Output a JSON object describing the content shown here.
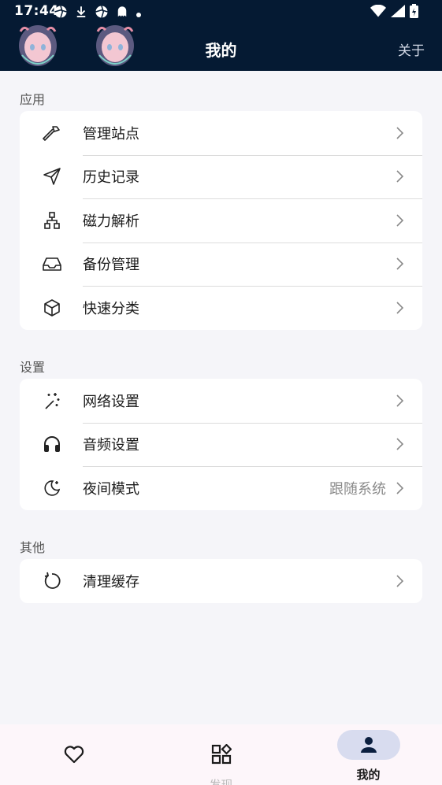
{
  "status_bar": {
    "time": "17:44",
    "left_icons": [
      "aperture-icon",
      "download-icon",
      "aperture-icon",
      "ghost-icon",
      "dot-icon"
    ],
    "right_icons": [
      "wifi-icon",
      "signal-icon",
      "battery-charging-icon"
    ]
  },
  "header": {
    "title": "我的",
    "about_label": "关于",
    "background": "#051a33"
  },
  "sections": [
    {
      "label": "应用",
      "items": [
        {
          "icon": "hammer-icon",
          "label": "管理站点"
        },
        {
          "icon": "send-icon",
          "label": "历史记录"
        },
        {
          "icon": "sitemap-icon",
          "label": "磁力解析"
        },
        {
          "icon": "inbox-icon",
          "label": "备份管理"
        },
        {
          "icon": "cube-icon",
          "label": "快速分类"
        }
      ]
    },
    {
      "label": "设置",
      "items": [
        {
          "icon": "sparkles-icon",
          "label": "网络设置"
        },
        {
          "icon": "headphones-icon",
          "label": "音频设置"
        },
        {
          "icon": "moon-icon",
          "label": "夜间模式",
          "value": "跟随系统"
        }
      ]
    },
    {
      "label": "其他",
      "items": [
        {
          "icon": "refresh-icon",
          "label": "清理缓存"
        }
      ]
    }
  ],
  "bottom_nav": {
    "items": [
      {
        "icon": "heart-icon",
        "label": ""
      },
      {
        "icon": "apps-icon",
        "label": "发现"
      },
      {
        "icon": "person-icon",
        "label": "我的",
        "active": true
      }
    ],
    "active_pill_color": "#d8dcef"
  }
}
